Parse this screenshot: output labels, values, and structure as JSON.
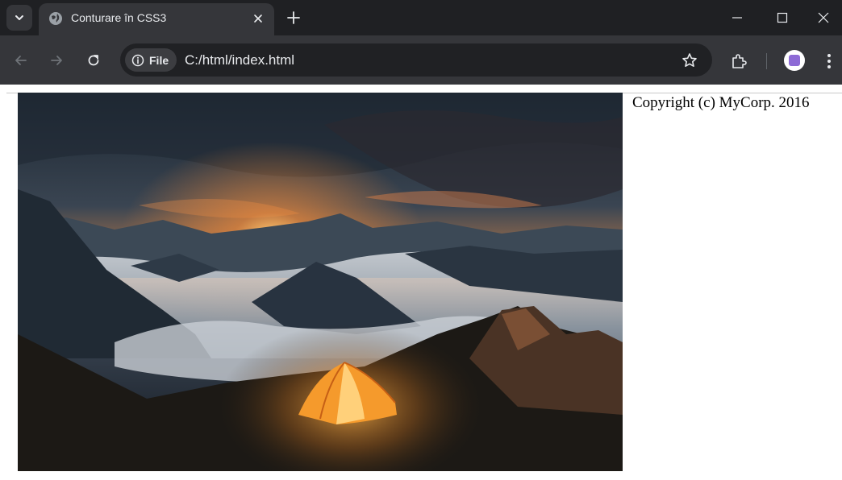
{
  "browser": {
    "tab": {
      "title": "Conturare în CSS3",
      "favicon": "globe-icon"
    },
    "omnibox": {
      "chip_label": "File",
      "url": "C:/html/index.html"
    }
  },
  "page": {
    "copyright": "Copyright (c) MyCorp. 2016",
    "image": {
      "subject": "orange tent on rocky mountain peak above sea of clouds at sunset"
    }
  },
  "colors": {
    "tabstrip": "#1f2023",
    "toolbar": "#35363a",
    "omnibox": "#202124",
    "text": "#e8eaed",
    "avatar_accent": "#8e6bd6"
  }
}
